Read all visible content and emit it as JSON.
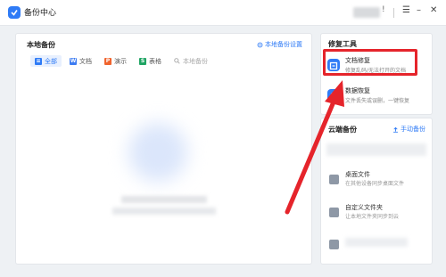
{
  "window": {
    "title": "备份中心",
    "info_mark": "!",
    "menu_glyph": "☰",
    "minimize_glyph": "–",
    "close_glyph": "✕"
  },
  "local_backup": {
    "title": "本地备份",
    "settings_link": "本地备份设置",
    "filters": [
      {
        "label": "全部",
        "icon": "all-files-icon",
        "active": true
      },
      {
        "label": "文档",
        "icon": "writer-doc-icon",
        "active": false
      },
      {
        "label": "演示",
        "icon": "presentation-icon",
        "active": false
      },
      {
        "label": "表格",
        "icon": "spreadsheet-icon",
        "active": false
      }
    ],
    "search_placeholder": "本地备份"
  },
  "repair_tools": {
    "title": "修复工具",
    "items": [
      {
        "title": "文档修复",
        "subtitle": "修复乱码/无法打开的文档",
        "icon": "document-repair-icon",
        "highlighted": true
      },
      {
        "title": "数据恢复",
        "subtitle": "文件丢失或误删，一键恢复",
        "icon": "data-recovery-icon",
        "highlighted": false
      }
    ]
  },
  "cloud_backup": {
    "title": "云端备份",
    "manual_link": "手动备份",
    "items": [
      {
        "title": "桌面文件",
        "subtitle": "在其他设备同步桌面文件",
        "icon": "desktop-files-icon"
      },
      {
        "title": "自定义文件夹",
        "subtitle": "让本地文件夹同步到云",
        "icon": "custom-folder-icon"
      }
    ]
  },
  "colors": {
    "accent": "#2f7bf6",
    "annotation": "#e5242b"
  }
}
